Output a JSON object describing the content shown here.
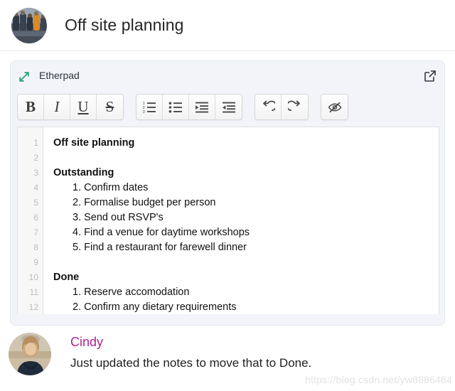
{
  "header": {
    "title": "Off site planning",
    "avatar_name": "group-photo-avatar"
  },
  "pad": {
    "app_name": "Etherpad",
    "expand_icon": "expand-arrows-icon",
    "popout_icon": "external-link-icon",
    "toolbar": {
      "groups": [
        {
          "name": "text-format",
          "buttons": [
            {
              "name": "bold-button",
              "label": "B",
              "style": "b"
            },
            {
              "name": "italic-button",
              "label": "I",
              "style": "i"
            },
            {
              "name": "underline-button",
              "label": "U",
              "style": "u"
            },
            {
              "name": "strikethrough-button",
              "label": "S",
              "style": "s"
            }
          ]
        },
        {
          "name": "list-format",
          "buttons": [
            {
              "name": "ordered-list-button",
              "icon": "ordered-list-icon"
            },
            {
              "name": "unordered-list-button",
              "icon": "bullet-list-icon"
            },
            {
              "name": "indent-button",
              "icon": "indent-icon"
            },
            {
              "name": "outdent-button",
              "icon": "outdent-icon"
            }
          ]
        },
        {
          "name": "history",
          "buttons": [
            {
              "name": "undo-button",
              "icon": "undo-icon"
            },
            {
              "name": "redo-button",
              "icon": "redo-icon"
            }
          ]
        },
        {
          "name": "authorship",
          "buttons": [
            {
              "name": "clear-authorship-colors-button",
              "icon": "eye-slash-icon"
            }
          ]
        }
      ]
    },
    "document": {
      "line_numbers": [
        "1",
        "2",
        "3",
        "4",
        "5",
        "6",
        "7",
        "8",
        "9",
        "10",
        "11",
        "12"
      ],
      "lines": [
        {
          "text": "Off site planning",
          "kind": "heading"
        },
        {
          "text": "",
          "kind": "blank"
        },
        {
          "text": "Outstanding",
          "kind": "heading"
        },
        {
          "text": "1. Confirm dates",
          "kind": "item"
        },
        {
          "text": "2. Formalise budget per person",
          "kind": "item"
        },
        {
          "text": "3. Send out RSVP's",
          "kind": "item"
        },
        {
          "text": "4. Find a venue for daytime workshops",
          "kind": "item"
        },
        {
          "text": "5. Find a restaurant for farewell dinner",
          "kind": "item"
        },
        {
          "text": "",
          "kind": "blank"
        },
        {
          "text": "Done",
          "kind": "heading"
        },
        {
          "text": "1. Reserve accomodation",
          "kind": "item"
        },
        {
          "text": "2. Confirm any dietary requirements",
          "kind": "item"
        }
      ]
    }
  },
  "comment": {
    "author": "Cindy",
    "author_color": "#b1238f",
    "text": "Just updated the notes to move that to Done.",
    "avatar_name": "cindy-avatar"
  },
  "watermark": {
    "text": "https://blog.csdn.net/yw8886484"
  }
}
